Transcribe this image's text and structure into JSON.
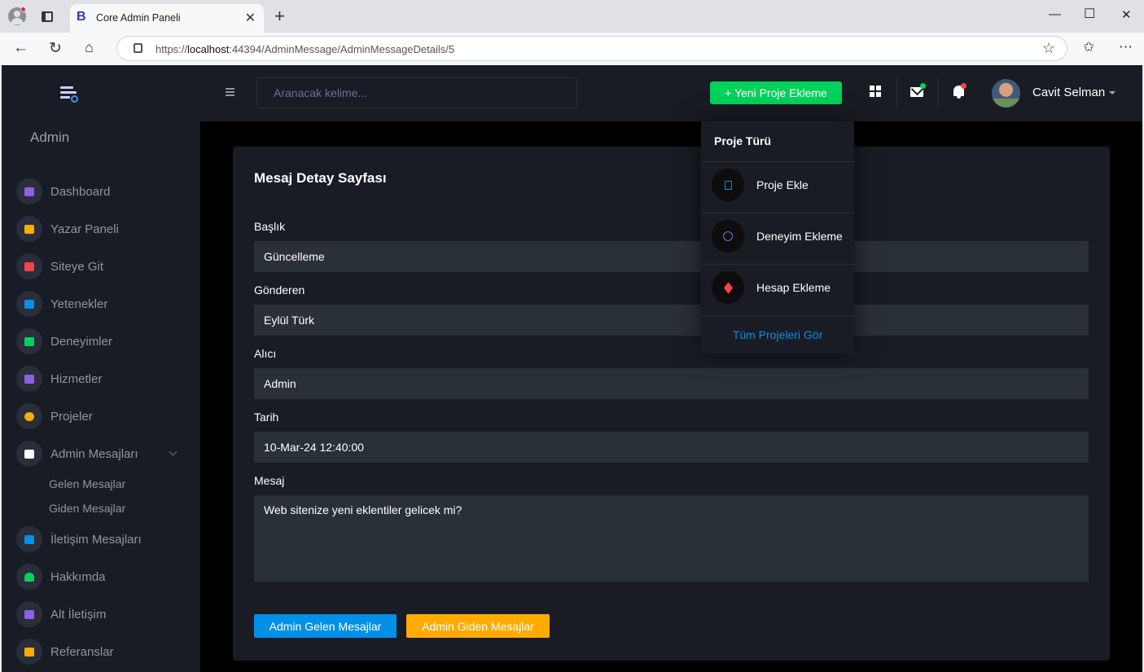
{
  "browser": {
    "tab_title": "Core Admin Paneli",
    "tab_favicon": "B",
    "url_prefix": "https://",
    "url_host": "localhost",
    "url_rest": ":44394/AdminMessage/AdminMessageDetails/5"
  },
  "sidebar": {
    "admin_label": "Admin",
    "items": [
      {
        "label": "Dashboard",
        "icon": "speedometer-icon",
        "color": "#8f5fe8"
      },
      {
        "label": "Yazar Paneli",
        "icon": "chat-alert-icon",
        "color": "#ffab00"
      },
      {
        "label": "Siteye Git",
        "icon": "table-icon",
        "color": "#fc424a"
      },
      {
        "label": "Yetenekler",
        "icon": "laptop-icon",
        "color": "#0090e7"
      },
      {
        "label": "Deneyimler",
        "icon": "playlist-icon",
        "color": "#00d25b"
      },
      {
        "label": "Hizmetler",
        "icon": "contacts-icon",
        "color": "#8f5fe8"
      },
      {
        "label": "Projeler",
        "icon": "github-icon",
        "color": "#ffab00"
      },
      {
        "label": "Admin Mesajları",
        "icon": "message-icon",
        "color": "#ffffff"
      },
      {
        "label": "İletişim Mesajları",
        "icon": "phone-icon",
        "color": "#0090e7"
      },
      {
        "label": "Hakkımda",
        "icon": "account-icon",
        "color": "#00d25b"
      },
      {
        "label": "Alt İletişim",
        "icon": "calendar-icon",
        "color": "#8f5fe8"
      },
      {
        "label": "Referanslar",
        "icon": "badge-icon",
        "color": "#ffab00"
      }
    ],
    "submenu": [
      "Gelen Mesajlar",
      "Giden Mesajlar"
    ]
  },
  "topnav": {
    "search_placeholder": "Aranacak kelime...",
    "new_project_button": "+ Yeni Proje Ekleme",
    "user_name": "Cavit Selman"
  },
  "dropdown": {
    "title": "Proje Türü",
    "items": [
      {
        "label": "Proje Ekle",
        "icon": "file-icon",
        "color": "#0090e7"
      },
      {
        "label": "Deneyim Ekleme",
        "icon": "web-icon",
        "color": "#8f5fe8"
      },
      {
        "label": "Hesap Ekleme",
        "icon": "layers-icon",
        "color": "#fc424a"
      }
    ],
    "footer": "Tüm Projeleri Gör"
  },
  "card": {
    "title": "Mesaj Detay Sayfası",
    "fields": [
      {
        "label": "Başlık",
        "value": "Güncelleme"
      },
      {
        "label": "Gönderen",
        "value": "Eylül Türk"
      },
      {
        "label": "Alıcı",
        "value": "Admin"
      },
      {
        "label": "Tarih",
        "value": "10-Mar-24 12:40:00"
      },
      {
        "label": "Mesaj",
        "value": "Web sitenize yeni eklentiler gelicek mi?"
      }
    ],
    "buttons": {
      "incoming": "Admin Gelen Mesajlar",
      "outgoing": "Admin Giden Mesajlar"
    }
  },
  "colors": {
    "primary": "#0090e7",
    "success": "#00d25b",
    "warning": "#ffab00",
    "danger": "#fc424a",
    "background": "#000000",
    "panel": "#191c24"
  }
}
